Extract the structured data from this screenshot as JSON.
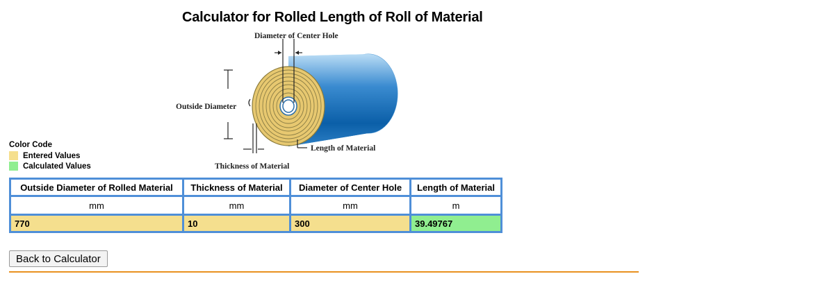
{
  "page": {
    "title": "Calculator for Rolled Length of Roll of Material"
  },
  "diagram": {
    "center_hole_label": "Diameter of Center Hole",
    "outside_diameter_label": "Outside Diameter",
    "length_label": "Length of Material",
    "thickness_label": "Thickness of Material"
  },
  "legend": {
    "title": "Color Code",
    "items": [
      {
        "label": "Entered Values",
        "color": "#f5df8e"
      },
      {
        "label": "Calculated Values",
        "color": "#90ee90"
      }
    ]
  },
  "table": {
    "headers": [
      "Outside Diameter of Rolled Material",
      "Thickness of Material",
      "Diameter of Center Hole",
      "Length of Material"
    ],
    "units": [
      "mm",
      "mm",
      "mm",
      "m"
    ],
    "values": [
      "770",
      "10",
      "300",
      "39.49767"
    ]
  },
  "buttons": {
    "back_label": "Back to Calculator"
  },
  "colors": {
    "entered": "#f5df8e",
    "calculated": "#90ee90",
    "table_border": "#4f8fd8",
    "rule": "#e8911f"
  }
}
